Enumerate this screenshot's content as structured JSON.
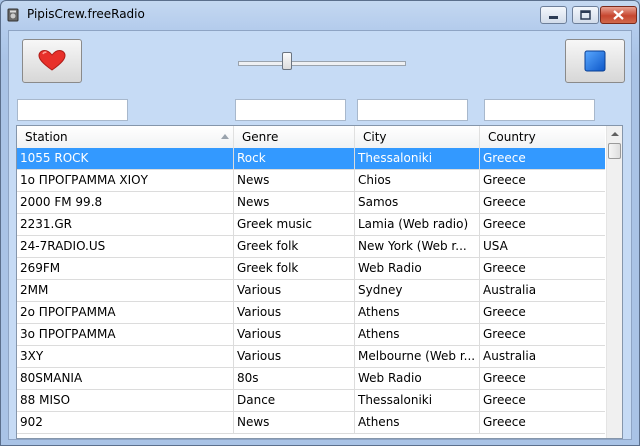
{
  "window": {
    "title": "PipisCrew.freeRadio"
  },
  "toolbar": {
    "volume": 0.28
  },
  "filters": {
    "station": "",
    "genre": "",
    "city": "",
    "country": ""
  },
  "table": {
    "columns": [
      "Station",
      "Genre",
      "City",
      "Country"
    ],
    "sort_column": "Station",
    "rows": [
      [
        "1055 ROCK",
        "Rock",
        "Thessaloniki",
        "Greece"
      ],
      [
        "1ο ΠΡΟΓΡΑΜΜΑ ΧΙΟΥ",
        "News",
        "Chios",
        "Greece"
      ],
      [
        "2000 FM 99.8",
        "News",
        "Samos",
        "Greece"
      ],
      [
        "2231.GR",
        "Greek music",
        "Lamia (Web radio)",
        "Greece"
      ],
      [
        "24-7RADIO.US",
        "Greek folk",
        "New York (Web r...",
        "USA"
      ],
      [
        "269FM",
        "Greek folk",
        "Web Radio",
        "Greece"
      ],
      [
        "2MM",
        "Various",
        "Sydney",
        "Australia"
      ],
      [
        "2ο ΠΡΟΓΡΑΜΜΑ",
        "Various",
        "Athens",
        "Greece"
      ],
      [
        "3ο ΠΡΟΓΡΑΜΜΑ",
        "Various",
        "Athens",
        "Greece"
      ],
      [
        "3XY",
        "Various",
        "Melbourne (Web r...",
        "Australia"
      ],
      [
        "80SMANIA",
        "80s",
        "Web Radio",
        "Greece"
      ],
      [
        "88 MISO",
        "Dance",
        "Thessaloniki",
        "Greece"
      ],
      [
        "902",
        "News",
        "Athens",
        "Greece"
      ]
    ],
    "selected_row": 0
  },
  "colors": {
    "selection": "#3399ff",
    "heart": "#e8302a",
    "stop": "#1a6fe0"
  }
}
